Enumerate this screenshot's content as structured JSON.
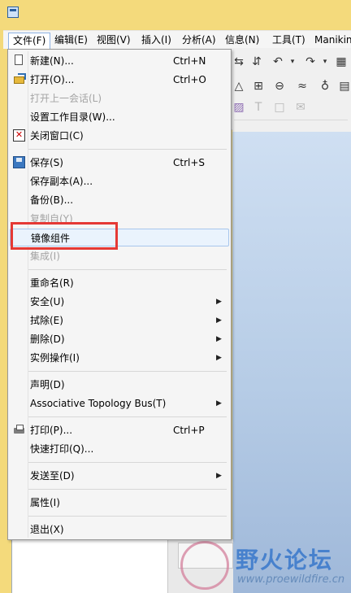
{
  "menubar": {
    "items": [
      "文件(F)",
      "编辑(E)",
      "视图(V)",
      "插入(I)",
      "分析(A)",
      "信息(N)",
      "工具(T)",
      "Manikin"
    ]
  },
  "file_menu": {
    "items": [
      {
        "label": "新建(N)...",
        "shortcut": "Ctrl+N",
        "icon": "new-document-icon",
        "enabled": true
      },
      {
        "label": "打开(O)...",
        "shortcut": "Ctrl+O",
        "icon": "open-folder-icon",
        "enabled": true
      },
      {
        "label": "打开上一会话(L)",
        "enabled": false
      },
      {
        "label": "设置工作目录(W)...",
        "enabled": true
      },
      {
        "label": "关闭窗口(C)",
        "icon": "close-window-icon",
        "enabled": true
      },
      {
        "label": "保存(S)",
        "shortcut": "Ctrl+S",
        "icon": "save-icon",
        "enabled": true
      },
      {
        "label": "保存副本(A)...",
        "enabled": true
      },
      {
        "label": "备份(B)...",
        "enabled": true
      },
      {
        "label": "复制自(Y)",
        "enabled": false
      },
      {
        "label": "镜像组件",
        "enabled": true,
        "highlighted": true
      },
      {
        "label": "集成(I)",
        "enabled": false
      },
      {
        "label": "重命名(R)",
        "enabled": true
      },
      {
        "label": "安全(U)",
        "enabled": true,
        "submenu": true
      },
      {
        "label": "拭除(E)",
        "enabled": true,
        "submenu": true
      },
      {
        "label": "删除(D)",
        "enabled": true,
        "submenu": true
      },
      {
        "label": "实例操作(I)",
        "enabled": true,
        "submenu": true
      },
      {
        "label": "声明(D)",
        "enabled": true
      },
      {
        "label": "Associative Topology Bus(T)",
        "enabled": true,
        "submenu": true
      },
      {
        "label": "打印(P)...",
        "shortcut": "Ctrl+P",
        "icon": "print-icon",
        "enabled": true
      },
      {
        "label": "快速打印(Q)...",
        "enabled": true
      },
      {
        "label": "发送至(D)",
        "enabled": true,
        "submenu": true
      },
      {
        "label": "属性(I)",
        "enabled": true
      },
      {
        "label": "退出(X)",
        "enabled": true
      }
    ],
    "submenu_arrow": "▶"
  },
  "watermark": {
    "title": "野火论坛",
    "url": "www.proewildfire.cn"
  },
  "colors": {
    "window_frame": "#f4da7c",
    "highlight_border": "#e53935",
    "menu_background": "#f5f5f5"
  }
}
